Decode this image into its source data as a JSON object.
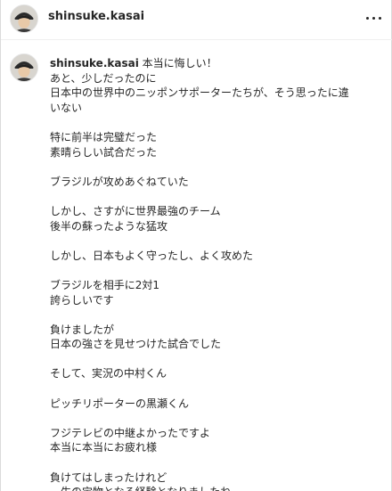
{
  "post": {
    "username": "shinsuke.kasai",
    "more_icon": "more-horizontal-icon",
    "avatar_icon": "profile-avatar-icon"
  },
  "caption": {
    "username": "shinsuke.kasai",
    "first_line": " 本当に悔しい！",
    "lines": [
      "あと、少しだったのに",
      "日本中の世界中のニッポンサポーターたちが、そう思ったに違",
      "いない",
      "",
      "特に前半は完璧だった",
      "素晴らしい試合だった",
      "",
      "ブラジルが攻めあぐねていた",
      "",
      "しかし、さすがに世界最強のチーム",
      "後半の蘇ったような猛攻",
      "",
      "しかし、日本もよく守ったし、よく攻めた",
      "",
      "ブラジルを相手に2対1",
      "誇らしいです",
      "",
      "負けましたが",
      "日本の強さを見せつけた試合でした",
      "",
      "そして、実況の中村くん",
      "",
      "ピッチリポーターの黒瀬くん",
      "",
      "フジテレビの中継よかったですよ",
      "本当に本当にお疲れ様",
      "",
      "負けてはしまったけれど",
      "一生の宝物となる経験となりましたね"
    ]
  }
}
